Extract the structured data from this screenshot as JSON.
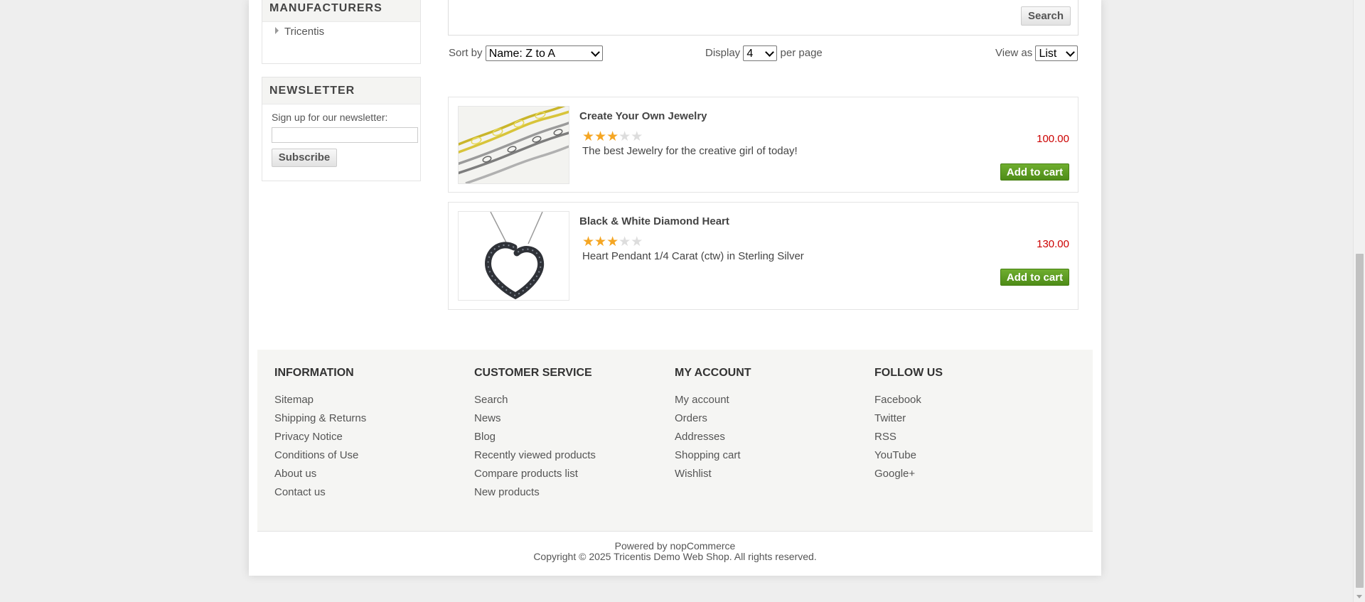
{
  "sidebar": {
    "manufacturers": {
      "title": "MANUFACTURERS",
      "items": [
        "Tricentis"
      ]
    },
    "newsletter": {
      "title": "NEWSLETTER",
      "label": "Sign up for our newsletter:",
      "input_value": "",
      "subscribe_label": "Subscribe"
    }
  },
  "search": {
    "button_label": "Search"
  },
  "toolbar": {
    "sort_label": "Sort by",
    "sort_value": "Name: Z to A",
    "display_label": "Display",
    "display_value": "4",
    "per_page_label": "per page",
    "view_label": "View as",
    "view_value": "List"
  },
  "products": [
    {
      "title": "Create Your Own Jewelry",
      "rating": 3,
      "rating_max": 5,
      "description": "The best Jewelry for the creative girl of today!",
      "price": "100.00",
      "cart_label": "Add to cart"
    },
    {
      "title": "Black & White Diamond Heart",
      "rating": 3,
      "rating_max": 5,
      "description": "Heart Pendant 1/4 Carat (ctw) in Sterling Silver",
      "price": "130.00",
      "cart_label": "Add to cart"
    }
  ],
  "footer": {
    "columns": [
      {
        "title": "INFORMATION",
        "links": [
          "Sitemap",
          "Shipping & Returns",
          "Privacy Notice",
          "Conditions of Use",
          "About us",
          "Contact us"
        ]
      },
      {
        "title": "CUSTOMER SERVICE",
        "links": [
          "Search",
          "News",
          "Blog",
          "Recently viewed products",
          "Compare products list",
          "New products"
        ]
      },
      {
        "title": "MY ACCOUNT",
        "links": [
          "My account",
          "Orders",
          "Addresses",
          "Shopping cart",
          "Wishlist"
        ]
      },
      {
        "title": "FOLLOW US",
        "links": [
          "Facebook",
          "Twitter",
          "RSS",
          "YouTube",
          "Google+"
        ]
      }
    ],
    "powered_by": "Powered by nopCommerce",
    "copyright": "Copyright © 2025 Tricentis Demo Web Shop. All rights reserved."
  },
  "colors": {
    "accent_green": "#5a9a1f",
    "price_red": "#cc0000",
    "star_gold": "#f5a623"
  }
}
